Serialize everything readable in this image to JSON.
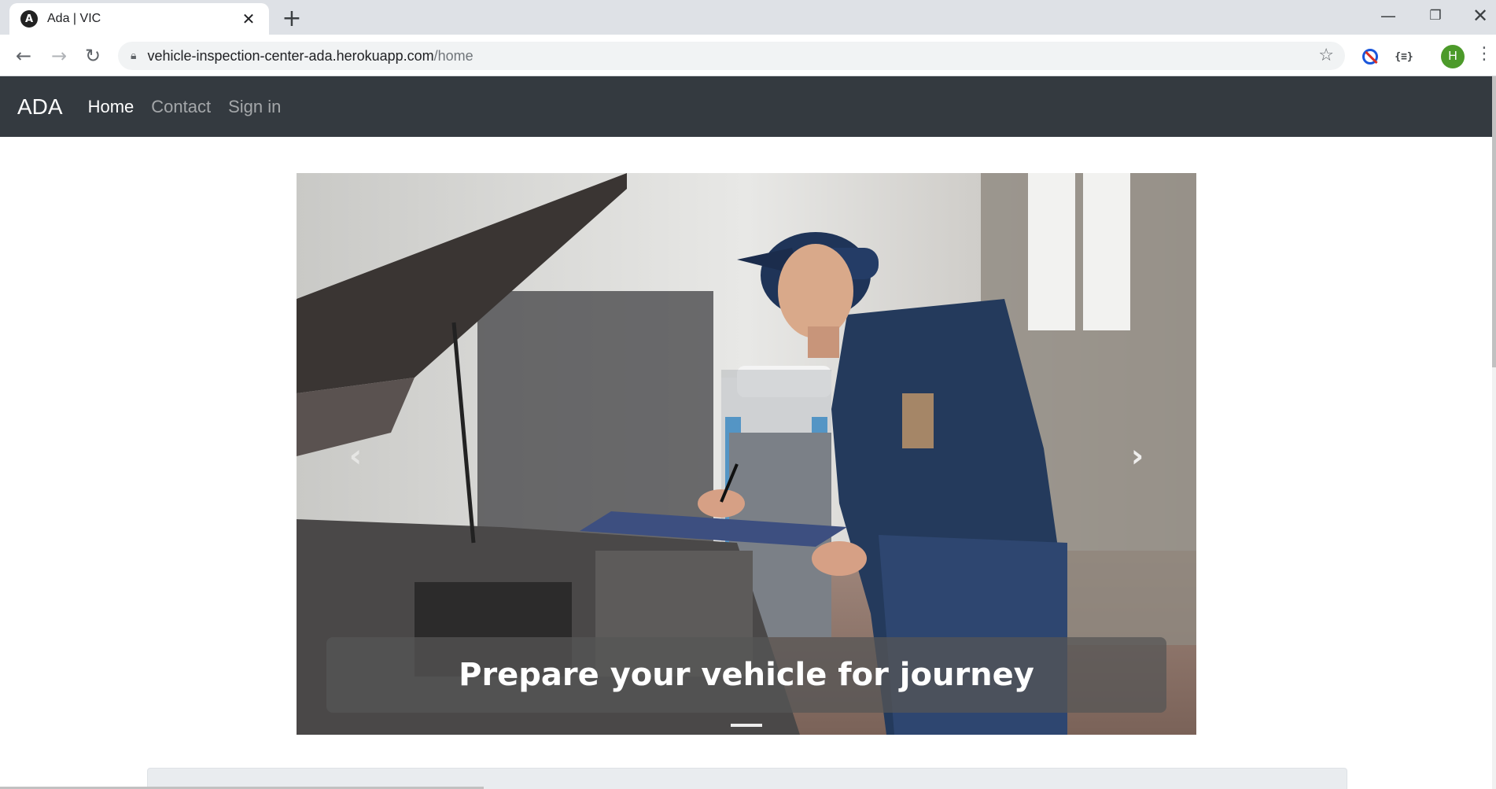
{
  "browser": {
    "tab_title": "Ada | VIC",
    "tab_favicon": "A",
    "url_host": "vehicle-inspection-center-ada.herokuapp.com",
    "url_path": "/home",
    "profile_initial": "H",
    "ext_json_label": "{≡}"
  },
  "navbar": {
    "brand": "ADA",
    "links": [
      "Home",
      "Contact",
      "Sign in"
    ]
  },
  "carousel": {
    "caption": "Prepare your vehicle for journey",
    "prev_glyph": "‹",
    "next_glyph": "›"
  },
  "colors": {
    "navbar_bg": "#343a40",
    "caption_bg": "#555555"
  }
}
